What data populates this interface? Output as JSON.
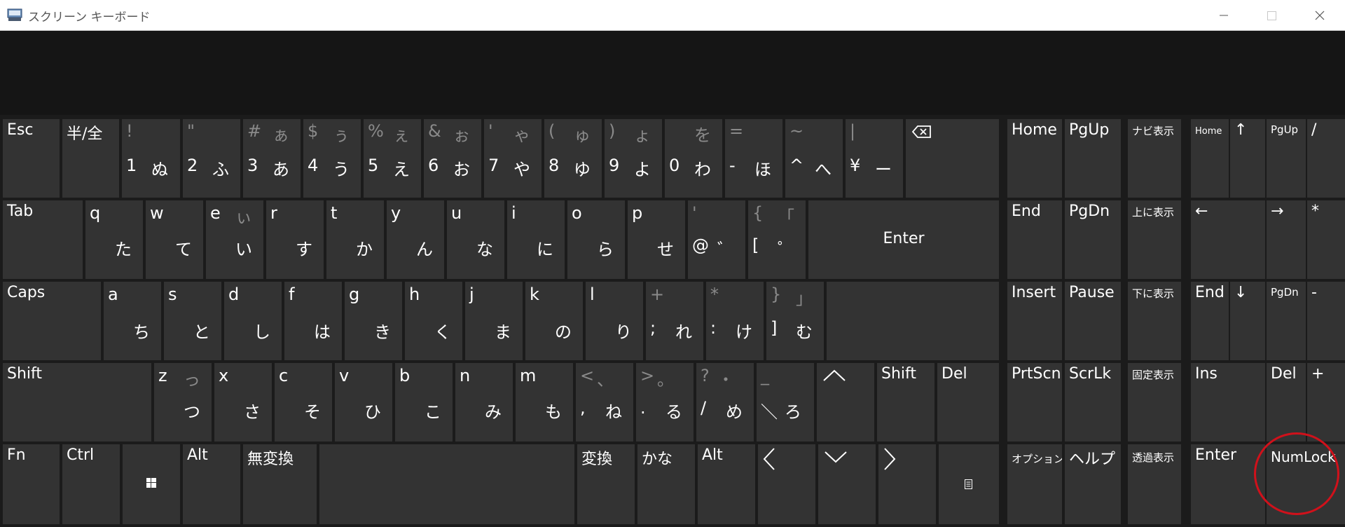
{
  "window": {
    "title": "スクリーン キーボード",
    "icon": "keyboard-app-icon",
    "controls": [
      "minimize-icon",
      "maximize-icon",
      "close-icon"
    ]
  },
  "keys": {
    "esc": "Esc",
    "hankaku": "半/全",
    "k1": {
      "sym": "!",
      "main": "1",
      "kana": "ぬ"
    },
    "k2": {
      "sym": "\"",
      "main": "2",
      "kana": "ふ"
    },
    "k3": {
      "sym": "#",
      "symkana": "ぁ",
      "main": "3",
      "kana": "あ"
    },
    "k4": {
      "sym": "$",
      "symkana": "ぅ",
      "main": "4",
      "kana": "う"
    },
    "k5": {
      "sym": "%",
      "symkana": "ぇ",
      "main": "5",
      "kana": "え"
    },
    "k6": {
      "sym": "&",
      "symkana": "ぉ",
      "main": "6",
      "kana": "お"
    },
    "k7": {
      "sym": "'",
      "symkana": "ゃ",
      "main": "7",
      "kana": "や"
    },
    "k8": {
      "sym": "(",
      "symkana": "ゅ",
      "main": "8",
      "kana": "ゆ"
    },
    "k9": {
      "sym": ")",
      "symkana": "ょ",
      "main": "9",
      "kana": "よ"
    },
    "k0": {
      "symkana": "を",
      "main": "0",
      "kana": "わ"
    },
    "minus": {
      "sym": "=",
      "main": "-",
      "kana": "ほ"
    },
    "caret": {
      "sym": "~",
      "main": "^",
      "kana": "へ"
    },
    "yen": {
      "sym": "|",
      "main": "¥",
      "kana": "ー"
    },
    "tab": "Tab",
    "q": {
      "main": "q",
      "kana": "た"
    },
    "w": {
      "main": "w",
      "kana": "て"
    },
    "e": {
      "main": "e",
      "symkana": "ぃ",
      "kana": "い"
    },
    "r": {
      "main": "r",
      "kana": "す"
    },
    "t": {
      "main": "t",
      "kana": "か"
    },
    "y": {
      "main": "y",
      "kana": "ん"
    },
    "u": {
      "main": "u",
      "kana": "な"
    },
    "i": {
      "main": "i",
      "kana": "に"
    },
    "o": {
      "main": "o",
      "kana": "ら"
    },
    "p": {
      "main": "p",
      "kana": "せ"
    },
    "at": {
      "sym": "'",
      "main": "@",
      "kana": "゛"
    },
    "bracket_l": {
      "sym": "{",
      "symkana": "「",
      "main": "[",
      "kana": "゜"
    },
    "enter": "Enter",
    "caps": "Caps",
    "a": {
      "main": "a",
      "kana": "ち"
    },
    "s": {
      "main": "s",
      "kana": "と"
    },
    "d": {
      "main": "d",
      "kana": "し"
    },
    "f": {
      "main": "f",
      "kana": "は"
    },
    "g": {
      "main": "g",
      "kana": "き"
    },
    "h": {
      "main": "h",
      "kana": "く"
    },
    "j": {
      "main": "j",
      "kana": "ま"
    },
    "k": {
      "main": "k",
      "kana": "の"
    },
    "l": {
      "main": "l",
      "kana": "り"
    },
    "semicolon": {
      "sym": "+",
      "main": ";",
      "kana": "れ"
    },
    "colon": {
      "sym": "*",
      "main": ":",
      "kana": "け"
    },
    "bracket_r": {
      "sym": "}",
      "symkana": "」",
      "main": "]",
      "kana": "む"
    },
    "shift": "Shift",
    "z": {
      "main": "z",
      "symkana": "っ",
      "kana": "つ"
    },
    "x": {
      "main": "x",
      "kana": "さ"
    },
    "c": {
      "main": "c",
      "kana": "そ"
    },
    "v": {
      "main": "v",
      "kana": "ひ"
    },
    "b": {
      "main": "b",
      "kana": "こ"
    },
    "n": {
      "main": "n",
      "kana": "み"
    },
    "m": {
      "main": "m",
      "kana": "も"
    },
    "comma": {
      "sym": "<",
      "symkana": "、",
      "main": ",",
      "kana": "ね"
    },
    "period": {
      "sym": ">",
      "symkana": "。",
      "main": ".",
      "kana": "る"
    },
    "slash": {
      "sym": "?",
      "symkana": "・",
      "main": "/",
      "kana": "め"
    },
    "backslash": {
      "sym": "_",
      "main": "＼",
      "kana": "ろ"
    },
    "shift_r": "Shift",
    "del": "Del",
    "fn": "Fn",
    "ctrl": "Ctrl",
    "alt": "Alt",
    "muhenkan": "無変換",
    "henkan": "変換",
    "kana": "かな",
    "alt_r": "Alt",
    "nav": {
      "home": "Home",
      "pgup": "PgUp",
      "navi": "ナビ表示",
      "end": "End",
      "pgdn": "PgDn",
      "up_show": "上に表示",
      "insert": "Insert",
      "pause": "Pause",
      "down_show": "下に表示",
      "prtscn": "PrtScn",
      "scrlk": "ScrLk",
      "fix_show": "固定表示",
      "option": "オプション",
      "help": "ヘルプ",
      "transparent": "透過表示"
    },
    "numpad": {
      "home": "Home",
      "up": "↑",
      "pgup": "PgUp",
      "slash": "/",
      "left": "←",
      "right": "→",
      "star": "*",
      "end": "End",
      "down": "↓",
      "pgdn": "PgDn",
      "minus": "-",
      "ins": "Ins",
      "del": "Del",
      "plus": "+",
      "enter": "Enter",
      "numlock": "NumLock"
    }
  }
}
